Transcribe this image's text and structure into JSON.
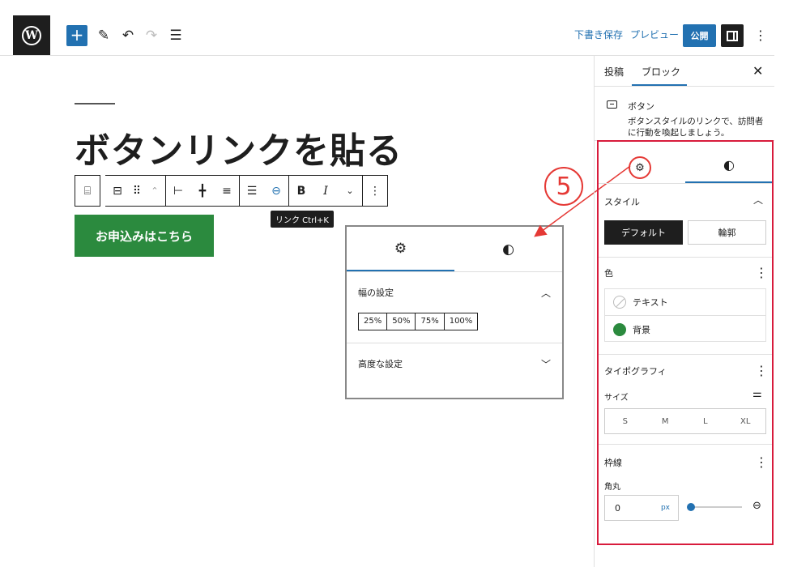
{
  "topbar": {
    "draft_label": "下書き保存",
    "preview_label": "プレビュー",
    "publish_label": "公開"
  },
  "editor": {
    "heading": "ボタンリンクを貼る",
    "button_text": "お申込みはこちら",
    "tooltip": "リンク Ctrl+K",
    "toolbar": {
      "bold": "B",
      "italic": "I"
    }
  },
  "popup": {
    "width_title": "幅の設定",
    "width_options": [
      "25%",
      "50%",
      "75%",
      "100%"
    ],
    "advanced_title": "高度な設定"
  },
  "annotation": {
    "step": "5"
  },
  "sidebar": {
    "tabs": [
      "投稿",
      "ブロック"
    ],
    "block": {
      "title": "ボタン",
      "description": "ボタンスタイルのリンクで、訪問者に行動を喚起しましょう。"
    },
    "style": {
      "title": "スタイル",
      "default_label": "デフォルト",
      "outline_label": "輪郭"
    },
    "color": {
      "title": "色",
      "text_label": "テキスト",
      "background_label": "背景",
      "background_color": "#2b8a3e"
    },
    "typography": {
      "title": "タイポグラフィ",
      "size_label": "サイズ",
      "sizes": [
        "S",
        "M",
        "L",
        "XL"
      ]
    },
    "border": {
      "title": "枠線",
      "radius_label": "角丸",
      "radius_value": "0",
      "radius_unit": "px"
    }
  }
}
